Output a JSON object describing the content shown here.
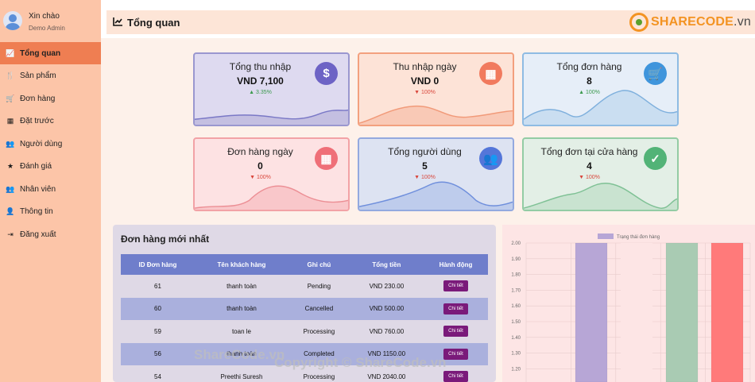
{
  "user": {
    "greeting": "Xin chào",
    "role": "Demo Admin"
  },
  "nav": [
    {
      "label": "Tổng quan",
      "icon": "chart-line-icon",
      "glyph": "📈",
      "active": true
    },
    {
      "label": "Sản phẩm",
      "icon": "utensils-icon",
      "glyph": "🍴"
    },
    {
      "label": "Đơn hàng",
      "icon": "cart-icon",
      "glyph": "🛒"
    },
    {
      "label": "Đặt trước",
      "icon": "calendar-icon",
      "glyph": "▦"
    },
    {
      "label": "Người dùng",
      "icon": "users-icon",
      "glyph": "👥"
    },
    {
      "label": "Đánh giá",
      "icon": "star-icon",
      "glyph": "★"
    },
    {
      "label": "Nhân viên",
      "icon": "staff-icon",
      "glyph": "👥"
    },
    {
      "label": "Thông tin",
      "icon": "user-icon",
      "glyph": "👤"
    },
    {
      "label": "Đăng xuất",
      "icon": "logout-icon",
      "glyph": "⇥"
    }
  ],
  "header": {
    "title": "Tổng quan"
  },
  "logo": {
    "part1": "SHARECODE",
    "part2": ".vn"
  },
  "stats": [
    {
      "label": "Tổng thu nhập",
      "value": "VND 7,100",
      "delta": "▲ 3.35%",
      "trend": "up",
      "icon": "dollar-icon",
      "glyph": "$",
      "bg": "#dedaf0",
      "border": "#9a97cf",
      "wave": "#bdb8dd",
      "line": "#7a78c6",
      "badge": "#6d63c5"
    },
    {
      "label": "Thu nhập ngày",
      "value": "VND 0",
      "delta": "▼ 100%",
      "trend": "down",
      "icon": "calendar-icon",
      "glyph": "▦",
      "bg": "#fde3d7",
      "border": "#f3a07e",
      "wave": "#f8c2ae",
      "line": "#f19a79",
      "badge": "#f17a5e"
    },
    {
      "label": "Tổng đơn hàng",
      "value": "8",
      "delta": "▲ 100%",
      "trend": "up",
      "icon": "cart-icon",
      "glyph": "🛒",
      "bg": "#e6eef8",
      "border": "#8ebbe3",
      "wave": "#c3d9ef",
      "line": "#7fb0dd",
      "badge": "#3f95dc"
    },
    {
      "label": "Đơn hàng ngày",
      "value": "0",
      "delta": "▼ 100%",
      "trend": "down",
      "icon": "calendar-icon",
      "glyph": "▦",
      "bg": "#fde2e3",
      "border": "#f2a2a6",
      "wave": "#f7c0c3",
      "line": "#ec8f95",
      "badge": "#ef6f78"
    },
    {
      "label": "Tổng người dùng",
      "value": "5",
      "delta": "▼ 100%",
      "trend": "down",
      "icon": "users-icon",
      "glyph": "👥",
      "bg": "#dde3f2",
      "border": "#93a9df",
      "wave": "#b7c6ea",
      "line": "#6f8fdc",
      "badge": "#5476d9"
    },
    {
      "label": "Tổng đơn tại cửa hàng",
      "value": "4",
      "delta": "▼ 100%",
      "trend": "down",
      "icon": "calendar-check-icon",
      "glyph": "✓",
      "bg": "#e3efe6",
      "border": "#93cca4",
      "wave": "#c2e0ca",
      "line": "#7fc195",
      "badge": "#52b377"
    }
  ],
  "orders": {
    "title": "Đơn hàng mới nhất",
    "columns": [
      "ID Đơn hàng",
      "Tên khách hàng",
      "Ghi chú",
      "Tổng tiền",
      "Hành động"
    ],
    "rows": [
      {
        "id": "61",
        "name": "thanh toàn",
        "note": "Pending",
        "total": "VND 230.00",
        "action": "Chi tiết"
      },
      {
        "id": "60",
        "name": "thanh toàn",
        "note": "Cancelled",
        "total": "VND 500.00",
        "action": "Chi tiết"
      },
      {
        "id": "59",
        "name": "toan le",
        "note": "Processing",
        "total": "VND 760.00",
        "action": "Chi tiết"
      },
      {
        "id": "56",
        "name": "thanh toàn",
        "note": "Completed",
        "total": "VND 1150.00",
        "action": "Chi tiết"
      },
      {
        "id": "54",
        "name": "Preethi Suresh",
        "note": "Processing",
        "total": "VND 2040.00",
        "action": "Chi tiết"
      }
    ]
  },
  "chart_data": {
    "type": "bar",
    "legend": "Trạng thái đơn hàng",
    "legend_position": "top",
    "y_ticks": [
      "2.00",
      "1.90",
      "1.80",
      "1.70",
      "1.60",
      "1.50",
      "1.40",
      "1.30",
      "1.20"
    ],
    "ylim": [
      1.15,
      2.0
    ],
    "grid": true,
    "values": [
      2,
      2,
      2,
      2
    ],
    "colors": [
      "#b7a6d6",
      "#fde5e5",
      "#a9cbb3",
      "#ff7a7a"
    ]
  },
  "watermarks": {
    "center": "ShareCode.vn",
    "copyright": "Copyright © ShareCode.vn"
  }
}
